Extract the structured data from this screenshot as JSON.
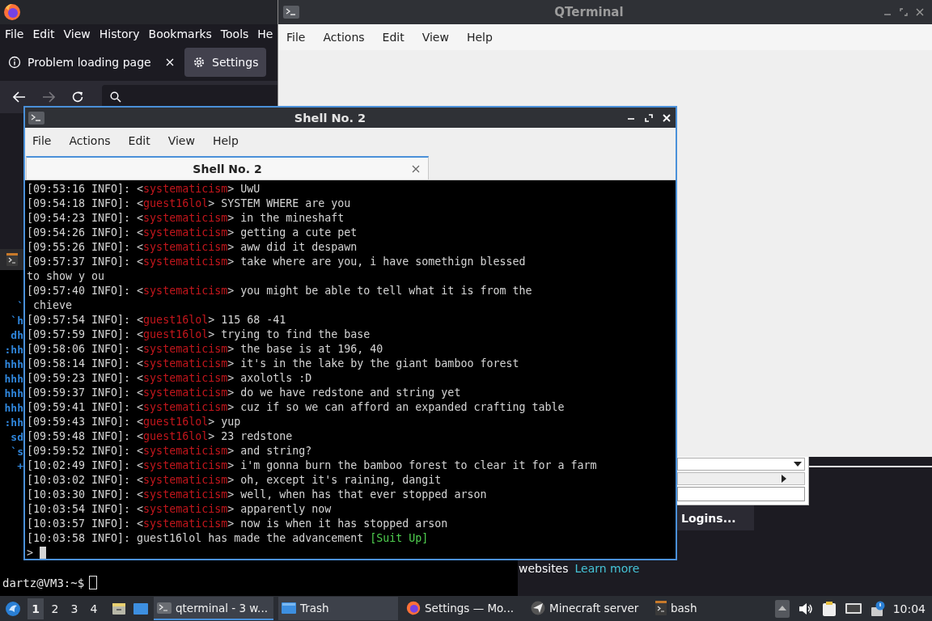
{
  "firefox": {
    "menu": [
      "File",
      "Edit",
      "View",
      "History",
      "Bookmarks",
      "Tools",
      "He"
    ],
    "tabs": [
      {
        "label": "Problem loading page",
        "kind": "info",
        "selected": false,
        "closable": true
      },
      {
        "label": "Settings",
        "kind": "gear",
        "selected": true,
        "closable": false
      }
    ],
    "page": {
      "text": "websites",
      "link": "Learn more",
      "button": "Logins..."
    }
  },
  "qterminal": {
    "title": "QTerminal",
    "menu": [
      "File",
      "Actions",
      "Edit",
      "View",
      "Help"
    ]
  },
  "bash": {
    "art": [
      "`",
      "`h",
      "dh",
      ":hh",
      "hhh",
      "hhh",
      "hhh",
      "hhh",
      ":hh",
      "sd",
      "`s",
      "+"
    ],
    "prompt": "dartz@VM3:~$"
  },
  "shell": {
    "title": "Shell No. 2",
    "menu": [
      "File",
      "Actions",
      "Edit",
      "View",
      "Help"
    ],
    "tab": "Shell No. 2",
    "lines": [
      {
        "kind": "chat",
        "prefix": "[09:53:16 INFO]: <",
        "sender": "systematicism",
        "message": "> UwU"
      },
      {
        "kind": "chat",
        "prefix": "[09:54:18 INFO]: <",
        "sender": "guest16lol",
        "message": "> SYSTEM WHERE are you"
      },
      {
        "kind": "chat",
        "prefix": "[09:54:23 INFO]: <",
        "sender": "systematicism",
        "message": "> in the mineshaft"
      },
      {
        "kind": "chat",
        "prefix": "[09:54:26 INFO]: <",
        "sender": "systematicism",
        "message": "> getting a cute pet"
      },
      {
        "kind": "chat",
        "prefix": "[09:55:26 INFO]: <",
        "sender": "systematicism",
        "message": "> aww did it despawn"
      },
      {
        "kind": "chat",
        "prefix": "[09:57:37 INFO]: <",
        "sender": "systematicism",
        "message": "> take where are you, i have somethign blessed"
      },
      {
        "kind": "plain",
        "text": "to show y ou"
      },
      {
        "kind": "chat",
        "prefix": "[09:57:40 INFO]: <",
        "sender": "systematicism",
        "message": "> you might be able to tell what it is from the"
      },
      {
        "kind": "plain",
        "text": " chieve"
      },
      {
        "kind": "chat",
        "prefix": "[09:57:54 INFO]: <",
        "sender": "guest16lol",
        "message": "> 115 68 -41"
      },
      {
        "kind": "chat",
        "prefix": "[09:57:59 INFO]: <",
        "sender": "guest16lol",
        "message": "> trying to find the base"
      },
      {
        "kind": "chat",
        "prefix": "[09:58:06 INFO]: <",
        "sender": "systematicism",
        "message": "> the base is at 196, 40"
      },
      {
        "kind": "chat",
        "prefix": "[09:58:14 INFO]: <",
        "sender": "systematicism",
        "message": "> it's in the lake by the giant bamboo forest"
      },
      {
        "kind": "chat",
        "prefix": "[09:59:23 INFO]: <",
        "sender": "systematicism",
        "message": "> axolotls :D"
      },
      {
        "kind": "chat",
        "prefix": "[09:59:37 INFO]: <",
        "sender": "systematicism",
        "message": "> do we have redstone and string yet"
      },
      {
        "kind": "chat",
        "prefix": "[09:59:41 INFO]: <",
        "sender": "systematicism",
        "message": "> cuz if so we can afford an expanded crafting table"
      },
      {
        "kind": "chat",
        "prefix": "[09:59:43 INFO]: <",
        "sender": "guest16lol",
        "message": "> yup"
      },
      {
        "kind": "chat",
        "prefix": "[09:59:48 INFO]: <",
        "sender": "guest16lol",
        "message": "> 23 redstone"
      },
      {
        "kind": "chat",
        "prefix": "[09:59:52 INFO]: <",
        "sender": "systematicism",
        "message": "> and string?"
      },
      {
        "kind": "chat",
        "prefix": "[10:02:49 INFO]: <",
        "sender": "systematicism",
        "message": "> i'm gonna burn the bamboo forest to clear it for a farm"
      },
      {
        "kind": "chat",
        "prefix": "[10:03:02 INFO]: <",
        "sender": "systematicism",
        "message": "> oh, except it's raining, dangit"
      },
      {
        "kind": "chat",
        "prefix": "[10:03:30 INFO]: <",
        "sender": "systematicism",
        "message": "> well, when has that ever stopped arson"
      },
      {
        "kind": "chat",
        "prefix": "[10:03:54 INFO]: <",
        "sender": "systematicism",
        "message": "> apparently now"
      },
      {
        "kind": "chat",
        "prefix": "[10:03:57 INFO]: <",
        "sender": "systematicism",
        "message": "> now is when it has stopped arson"
      },
      {
        "kind": "advancement",
        "prefix": "[10:03:58 INFO]: guest16lol has made the advancement ",
        "highlight": "[Suit Up]"
      }
    ],
    "prompt": ">"
  },
  "taskbar": {
    "desktops": [
      {
        "label": "1",
        "selected": true
      },
      {
        "label": "2",
        "selected": false
      },
      {
        "label": "3",
        "selected": false
      },
      {
        "label": "4",
        "selected": false
      }
    ],
    "tasks": [
      {
        "label": "qterminal - 3 w...",
        "kind": "terminal",
        "selected": true,
        "highlighted": true
      },
      {
        "label": "Trash",
        "kind": "folder",
        "selected": false,
        "highlighted": true
      },
      {
        "label": "Settings — Mo...",
        "kind": "browser",
        "selected": false,
        "highlighted": false
      },
      {
        "label": "Minecraft server",
        "kind": "app",
        "selected": false,
        "highlighted": false
      },
      {
        "label": "bash",
        "kind": "shell",
        "selected": false,
        "highlighted": false
      }
    ],
    "clock": "10:04"
  }
}
